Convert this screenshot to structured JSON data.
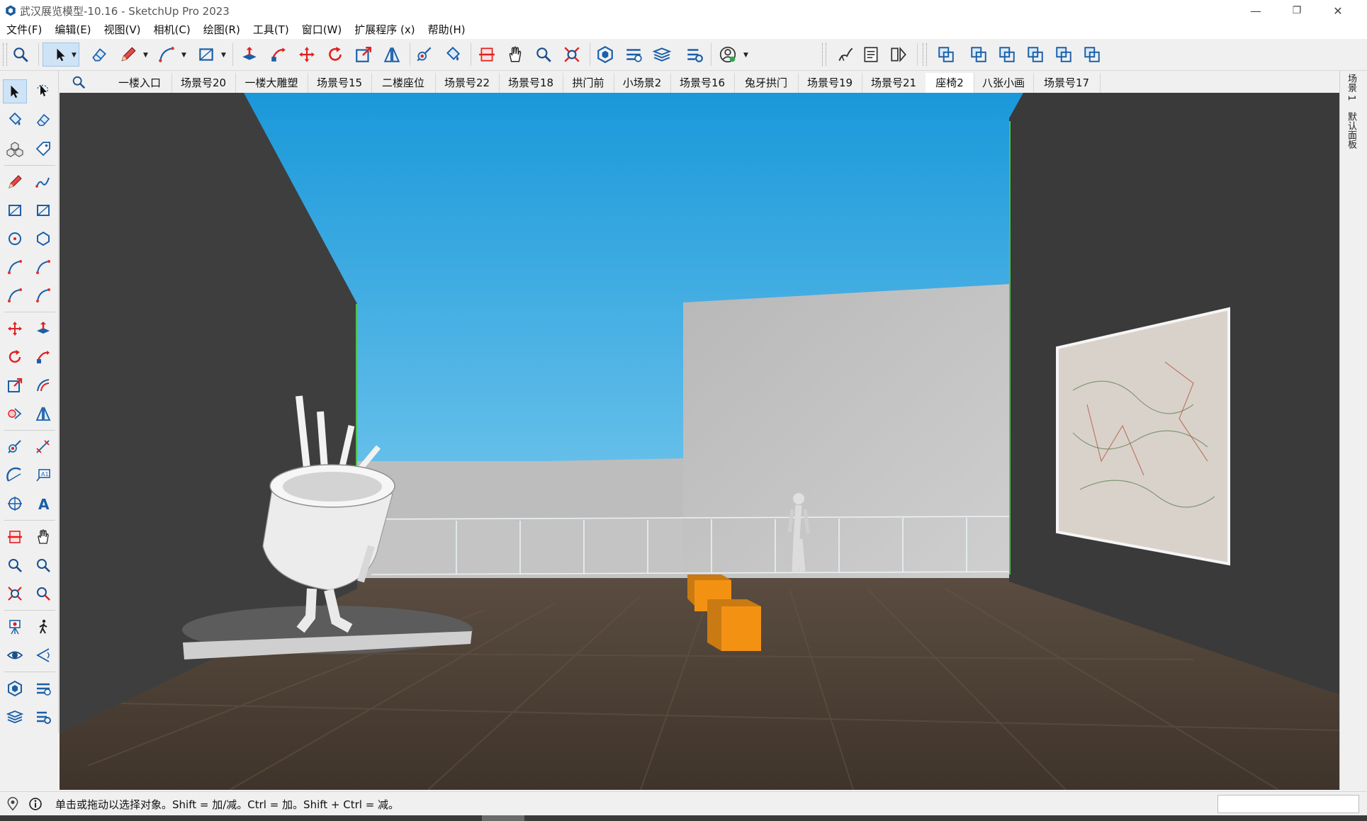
{
  "window": {
    "title": "武汉展览模型-10.16 - SketchUp Pro 2023",
    "icons": {
      "app": "sketchup-logo-icon",
      "minimize": "minimize-icon",
      "restore": "restore-icon",
      "close": "close-icon"
    },
    "controls": {
      "minimize": "—",
      "restore": "❐",
      "close": "✕"
    }
  },
  "menu": [
    "文件(F)",
    "编辑(E)",
    "视图(V)",
    "相机(C)",
    "绘图(R)",
    "工具(T)",
    "窗口(W)",
    "扩展程序 (x)",
    "帮助(H)"
  ],
  "toolbar": {
    "groups": [
      [
        "search-icon"
      ],
      [
        "select-icon",
        "eraser-icon",
        "pencil-icon",
        "arc-icon",
        "rectangle-icon"
      ],
      [
        "push-pull-icon",
        "follow-me-icon",
        "move-icon",
        "rotate-icon",
        "scale-icon",
        "flip-icon"
      ],
      [
        "tape-measure-icon",
        "paint-bucket-icon"
      ],
      [
        "section-plane-icon",
        "pan-icon",
        "zoom-icon",
        "zoom-extents-icon"
      ],
      [
        "warehouse-icon",
        "extension-warehouse-icon",
        "layout-icon",
        "extension-manager-icon",
        "account-icon"
      ],
      [
        "sandbox-icon",
        "model-info-icon",
        "scenes-compare-icon"
      ],
      [
        "iso-view-icon",
        "top-view-icon",
        "front-view-icon",
        "right-view-icon",
        "back-view-icon",
        "left-view-icon"
      ]
    ]
  },
  "left_toolbar": [
    [
      "select-icon",
      "lasso-select-icon"
    ],
    [
      "paint-bucket-icon",
      "eraser-icon"
    ],
    [
      "component-icon",
      "tag-icon"
    ],
    [
      "line-icon",
      "freehand-icon"
    ],
    [
      "rectangle-icon",
      "rotated-rectangle-icon"
    ],
    [
      "circle-icon",
      "polygon-icon"
    ],
    [
      "arc-icon",
      "two-point-arc-icon"
    ],
    [
      "three-point-arc-icon",
      "pie-icon"
    ],
    [
      "move-icon",
      "push-pull-icon"
    ],
    [
      "rotate-icon",
      "follow-me-icon"
    ],
    [
      "scale-icon",
      "offset-icon"
    ],
    [
      "solid-tools-icon",
      "flip-icon"
    ],
    [
      "tape-measure-icon",
      "dimension-icon"
    ],
    [
      "protractor-icon",
      "text-icon"
    ],
    [
      "axes-icon",
      "3d-text-icon"
    ],
    [
      "section-plane-icon",
      "section-fill-icon"
    ],
    [
      "zoom-icon",
      "zoom-window-icon"
    ],
    [
      "zoom-extents-icon",
      "previous-view-icon"
    ],
    [
      "position-camera-icon",
      "walk-icon"
    ],
    [
      "look-around-icon",
      "field-of-view-icon"
    ],
    [
      "warehouse-icon",
      "extension-warehouse-icon"
    ],
    [
      "layout-icon",
      "extension-manager-icon"
    ]
  ],
  "scenes": {
    "search_icon": "search-icon",
    "tabs": [
      "一楼入口",
      "场景号20",
      "一楼大雕塑",
      "场景号15",
      "二楼座位",
      "场景号22",
      "场景号18",
      "拱门前",
      "小场景2",
      "场景号16",
      "兔牙拱门",
      "场景号19",
      "场景号21",
      "座椅2",
      "八张小画",
      "场景号17"
    ],
    "active": "座椅2"
  },
  "right_panel": {
    "tabs": [
      "场景 1",
      "默认面板"
    ]
  },
  "status": {
    "text": "单击或拖动以选择对象。Shift = 加/减。Ctrl = 加。Shift + Ctrl = 减。",
    "icons": [
      "geo-location-icon",
      "info-icon"
    ],
    "measurements": ""
  },
  "colors": {
    "accent": "#1e6fc0",
    "sky_top": "#1a98da",
    "sky_bottom": "#d7ecf5",
    "floor": "#4a3e34",
    "wall": "#3d3d3d",
    "bench": "#f39212"
  }
}
